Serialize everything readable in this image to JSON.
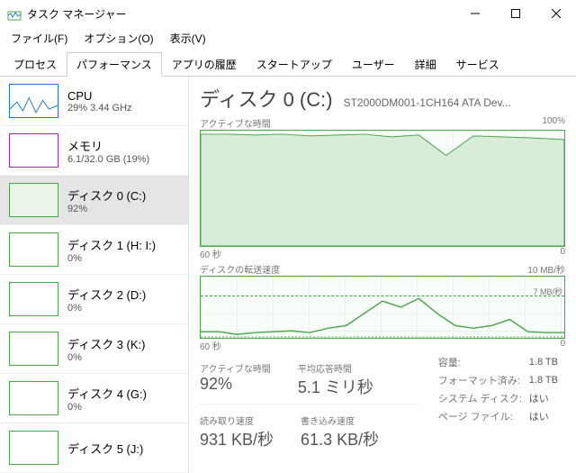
{
  "window": {
    "title": "タスク マネージャー"
  },
  "menu": {
    "file": "ファイル(F)",
    "options": "オプション(O)",
    "view": "表示(V)"
  },
  "tabs": [
    "プロセス",
    "パフォーマンス",
    "アプリの履歴",
    "スタートアップ",
    "ユーザー",
    "詳細",
    "サービス"
  ],
  "active_tab": 1,
  "side_items": [
    {
      "name": "CPU",
      "val": "29%  3.44 GHz",
      "kind": "cpu"
    },
    {
      "name": "メモリ",
      "val": "6.1/32.0 GB (19%)",
      "kind": "mem"
    },
    {
      "name": "ディスク 0 (C:)",
      "val": "92%",
      "kind": "disk",
      "selected": true,
      "filled": true
    },
    {
      "name": "ディスク 1 (H: I:)",
      "val": "0%",
      "kind": "disk"
    },
    {
      "name": "ディスク 2 (D:)",
      "val": "0%",
      "kind": "disk"
    },
    {
      "name": "ディスク 3 (K:)",
      "val": "0%",
      "kind": "disk"
    },
    {
      "name": "ディスク 4 (G:)",
      "val": "0%",
      "kind": "disk"
    },
    {
      "name": "ディスク 5 (J:)",
      "val": "",
      "kind": "disk"
    }
  ],
  "header": {
    "title": "ディスク 0 (C:)",
    "sub": "ST2000DM001-1CH164 ATA Dev..."
  },
  "chart1": {
    "title": "アクティブな時間",
    "max": "100%",
    "xleft": "60 秒",
    "xright": "0"
  },
  "chart2": {
    "title": "ディスクの転送速度",
    "max": "10 MB/秒",
    "dashed": "7 MB/秒",
    "xleft": "60 秒",
    "xright": "0"
  },
  "stats_row1": [
    {
      "label": "アクティブな時間",
      "value": "92%"
    },
    {
      "label": "平均応答時間",
      "value": "5.1 ミリ秒"
    }
  ],
  "stats_row2": [
    {
      "label": "読み取り速度",
      "value": "931 KB/秒"
    },
    {
      "label": "書き込み速度",
      "value": "61.3 KB/秒"
    }
  ],
  "info": [
    [
      "容量:",
      "1.8 TB"
    ],
    [
      "フォーマット済み:",
      "1.8 TB"
    ],
    [
      "システム ディスク:",
      "はい"
    ],
    [
      "ページ ファイル:",
      "はい"
    ]
  ],
  "chart_data": [
    {
      "type": "area",
      "title": "アクティブな時間",
      "xlabel": "秒",
      "ylabel": "%",
      "xlim": [
        60,
        0
      ],
      "ylim": [
        0,
        100
      ],
      "x": [
        60,
        55,
        50,
        45,
        40,
        35,
        30,
        25,
        20,
        15,
        10,
        5,
        0
      ],
      "values": [
        98,
        98,
        97,
        98,
        96,
        97,
        98,
        95,
        97,
        78,
        96,
        95,
        92
      ]
    },
    {
      "type": "line",
      "title": "ディスクの転送速度",
      "xlabel": "秒",
      "ylabel": "MB/秒",
      "xlim": [
        60,
        0
      ],
      "ylim": [
        0,
        10
      ],
      "series": [
        {
          "name": "read",
          "values": [
            1,
            1,
            0.5,
            0.8,
            1,
            1.2,
            0.8,
            1.5,
            2,
            4,
            6,
            5,
            6.5,
            4,
            2,
            1.5,
            2,
            3,
            1,
            0.8,
            0.9
          ]
        },
        {
          "name": "write",
          "values": [
            0.1,
            0.1,
            0.1,
            0.1,
            0.1,
            0.1,
            0.1,
            0.1,
            0.1,
            0.1,
            0.1,
            0.1,
            0.1,
            0.1,
            0.1,
            0.1,
            0.1,
            0.1,
            0.1,
            0.1,
            0.06
          ]
        }
      ],
      "dashed_ref": 7
    }
  ]
}
